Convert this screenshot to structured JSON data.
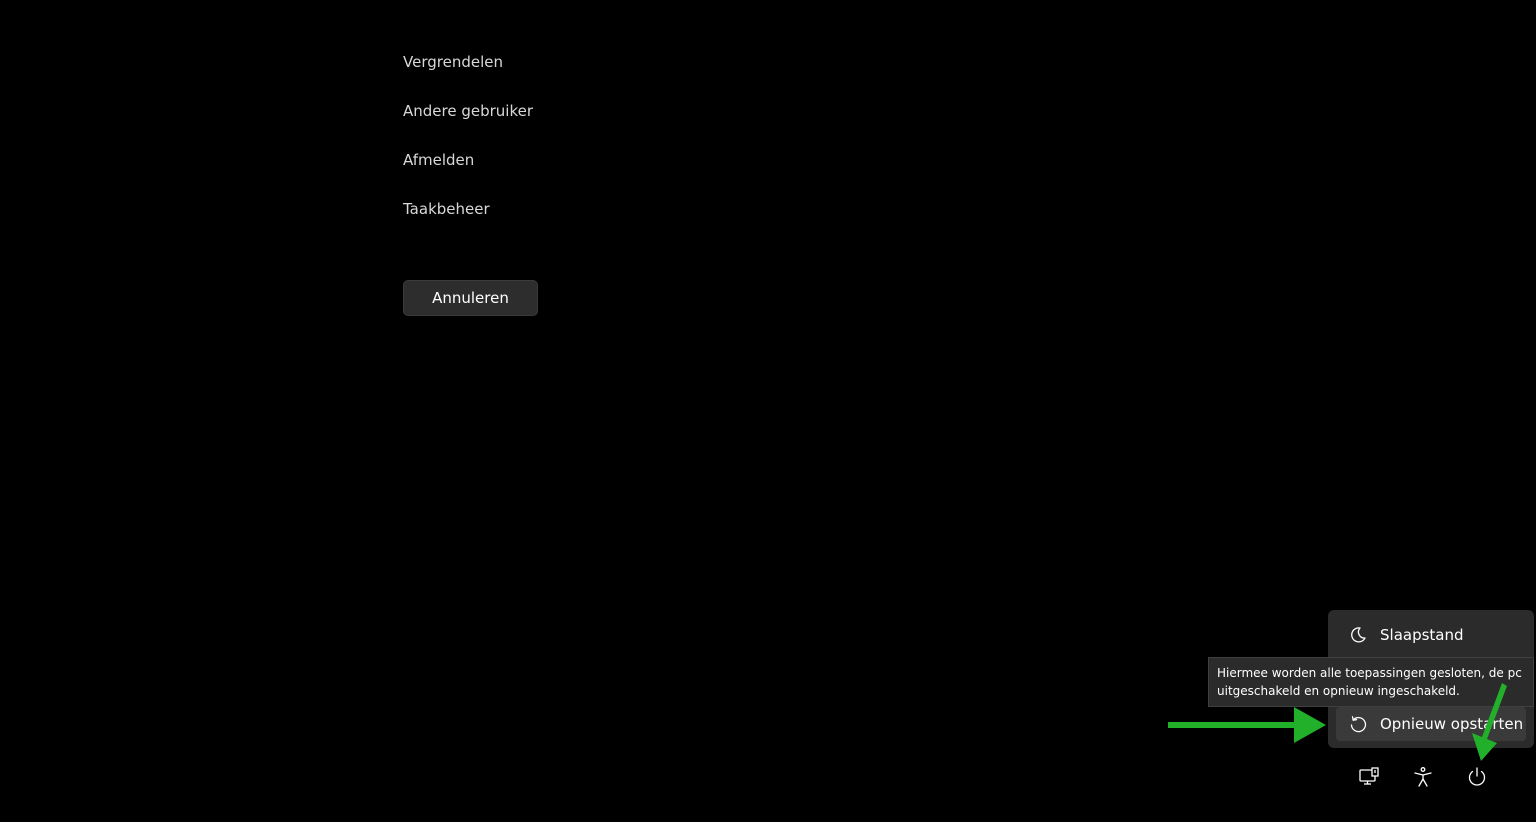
{
  "menu": {
    "items": [
      {
        "label": "Vergrendelen"
      },
      {
        "label": "Andere gebruiker"
      },
      {
        "label": "Afmelden"
      },
      {
        "label": "Taakbeheer"
      }
    ],
    "cancel_label": "Annuleren"
  },
  "power_menu": {
    "sleep_label": "Slaapstand",
    "restart_label": "Opnieuw opstarten",
    "sleep_icon": "moon-icon",
    "restart_icon": "restart-icon"
  },
  "tooltip": {
    "line1": "Hiermee worden alle toepassingen gesloten, de pc",
    "line2": "uitgeschakeld en opnieuw ingeschakeld."
  },
  "bottom_icons": [
    "network-icon",
    "accessibility-icon",
    "power-icon"
  ],
  "colors": {
    "background": "#000000",
    "menu_bg": "#2b2b2b",
    "annotation_arrow": "#22b02a"
  }
}
